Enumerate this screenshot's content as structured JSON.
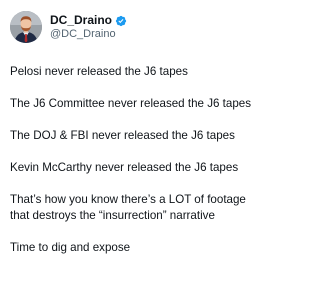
{
  "author": {
    "display_name": "DC_Draino",
    "handle": "@DC_Draino",
    "verified_icon": "verified-badge-icon",
    "avatar_icon": "profile-avatar"
  },
  "colors": {
    "verified": "#1d9bf0",
    "text": "#0f1419",
    "muted": "#536471",
    "background": "#ffffff"
  },
  "tweet": {
    "paragraphs": [
      "Pelosi never released the J6 tapes",
      "The J6 Committee never released the J6 tapes",
      "The DOJ & FBI never released the J6 tapes",
      "Kevin McCarthy never released the J6 tapes",
      "That’s how you know there’s a LOT of footage that destroys the “insurrection” narrative",
      "Time to dig and expose"
    ]
  }
}
